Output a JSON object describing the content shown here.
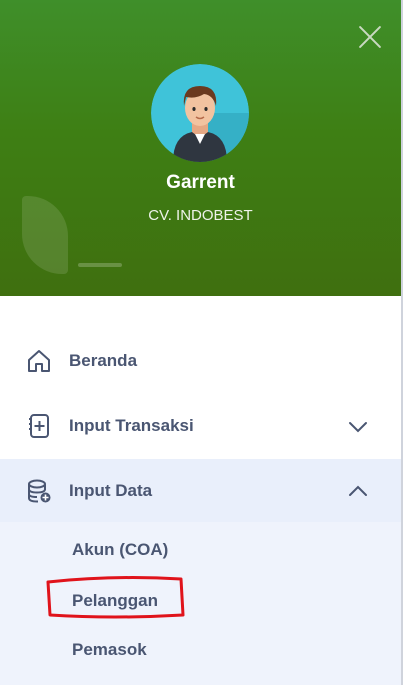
{
  "profile": {
    "name": "Garrent",
    "company": "CV. INDOBEST"
  },
  "menu": {
    "items": [
      {
        "label": "Beranda",
        "icon": "home-icon"
      },
      {
        "label": "Input Transaksi",
        "icon": "document-plus-icon"
      },
      {
        "label": "Input Data",
        "icon": "database-icon"
      }
    ],
    "submenu": [
      {
        "label": "Akun (COA)"
      },
      {
        "label": "Pelanggan"
      },
      {
        "label": "Pemasok"
      }
    ]
  },
  "colors": {
    "header_green": "#3e7f14",
    "text": "#4a5672",
    "active_bg": "#e9effb",
    "annotation_red": "#e0131b"
  }
}
